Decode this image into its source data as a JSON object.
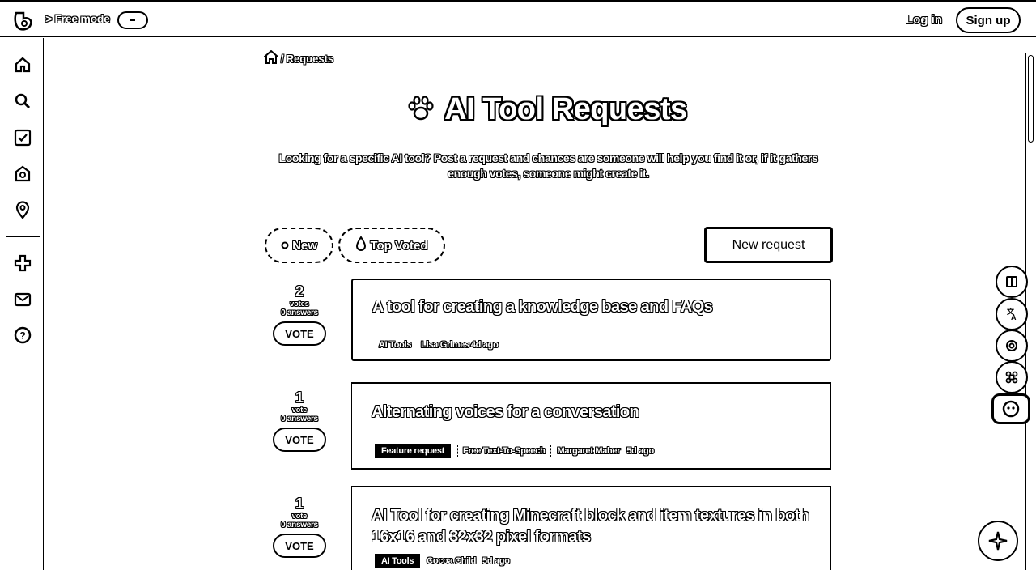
{
  "topbar": {
    "free_mode_label": "> Free mode",
    "login_label": "Log in",
    "signup_label": "Sign up"
  },
  "sidebar": {
    "items": [
      {
        "icon": "home-icon"
      },
      {
        "icon": "search-icon"
      },
      {
        "icon": "checkbox-icon"
      },
      {
        "icon": "badge-icon"
      },
      {
        "icon": "location-pin-icon"
      },
      {
        "icon": "plus-cross-icon"
      },
      {
        "icon": "mail-icon"
      },
      {
        "icon": "help-icon"
      }
    ]
  },
  "breadcrumb": {
    "separator": "/",
    "current": "Requests"
  },
  "page": {
    "title": "AI Tool Requests",
    "subtitle": "Looking for a specific AI tool? Post a request and chances are someone will help you find it or, if it gathers enough votes, someone might create it."
  },
  "tabs": {
    "new_label": "New",
    "top_voted_label": "Top Voted"
  },
  "new_request_label": "New request",
  "requests": [
    {
      "votes": "2",
      "vote_word": "votes",
      "answers": "0 answers",
      "vote_button": "VOTE",
      "title": "A tool for creating a knowledge base and FAQs",
      "tags": [
        "AI Tools",
        "Lisa Grimes",
        "4d ago"
      ]
    },
    {
      "votes": "1",
      "vote_word": "vote",
      "answers": "0 answers",
      "vote_button": "VOTE",
      "title": "Alternating voices for a conversation",
      "tags": [
        "Feature request",
        "Free Text-To-Speech",
        "Margaret Maher",
        "5d ago"
      ]
    },
    {
      "votes": "1",
      "vote_word": "vote",
      "answers": "0 answers",
      "vote_button": "VOTE",
      "title": "AI Tool for creating Minecraft block and item textures in both 16x16 and 32x32 pixel formats",
      "tags": [
        "AI Tools",
        "Cocoa Child",
        "5d ago"
      ]
    }
  ],
  "floating": {
    "buttons": [
      "book-icon",
      "translate-icon",
      "fingerprint-icon",
      "command-icon",
      "face-icon"
    ],
    "main": "sparkle-icon"
  }
}
